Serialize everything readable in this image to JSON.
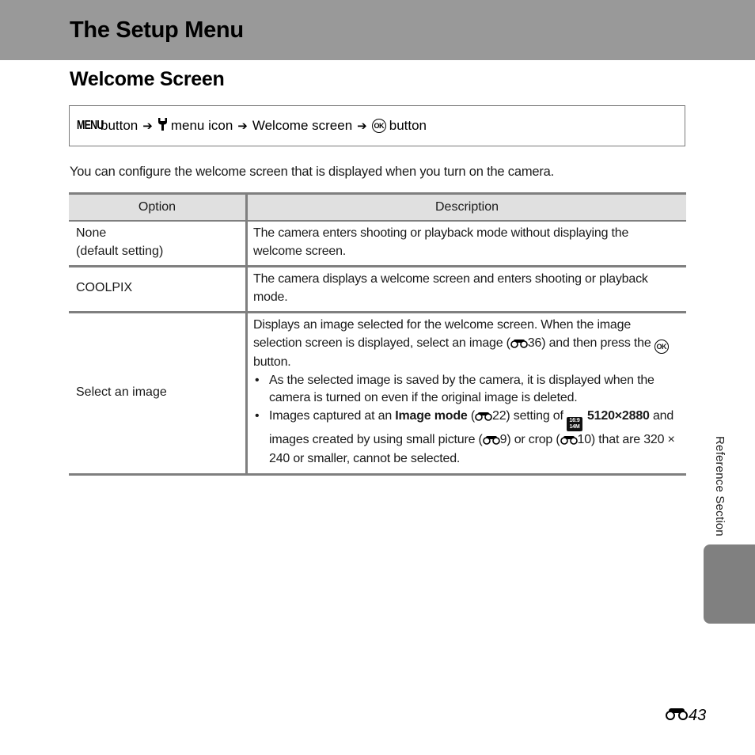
{
  "header": {
    "title": "The Setup Menu",
    "background_color": "#999999"
  },
  "section": {
    "title": "Welcome Screen"
  },
  "navigation_path": {
    "steps": [
      {
        "icon": "menu-button-icon",
        "icon_text": "MENU",
        "label": "button"
      },
      {
        "icon": "wrench-icon",
        "label": "menu icon"
      },
      {
        "label": "Welcome screen"
      },
      {
        "icon": "ok-button-icon",
        "icon_text": "OK",
        "label": "button"
      }
    ]
  },
  "intro": "You can configure the welcome screen that is displayed when you turn on the camera.",
  "table": {
    "headers": [
      "Option",
      "Description"
    ],
    "rows": [
      {
        "option_line1": "None",
        "option_line2": "(default setting)",
        "description": "The camera enters shooting or playback mode without displaying the welcome screen."
      },
      {
        "option_line1": "COOLPIX",
        "description": "The camera displays a welcome screen and enters shooting or playback mode."
      },
      {
        "option_line1": "Select an image",
        "description_part1": "Displays an image selected for the welcome screen. When the image selection screen is displayed, select an image (",
        "description_ref1": "36",
        "description_part2": ") and then press the",
        "description_part3": "button.",
        "ok_icon_text": "OK",
        "bullets": [
          {
            "text": "As the selected image is saved by the camera, it is displayed when the camera is turned on even if the original image is deleted."
          },
          {
            "text_a": "Images captured at an",
            "bold_a": "Image mode",
            "ref_a": "22",
            "text_b": "setting of",
            "mode_icon_top": "16:9",
            "mode_icon_bottom": "14M",
            "bold_b": "5120×2880",
            "text_c": "and images created by using small picture (",
            "ref_b": "9",
            "text_d": ") or crop (",
            "ref_c": "10",
            "text_e": ") that are 320 × 240 or smaller, cannot be selected."
          }
        ]
      }
    ]
  },
  "side_tab": {
    "label": "Reference Section",
    "tab_color": "#808080"
  },
  "page_number": {
    "icon": "reference-section-icon",
    "number": "43"
  }
}
